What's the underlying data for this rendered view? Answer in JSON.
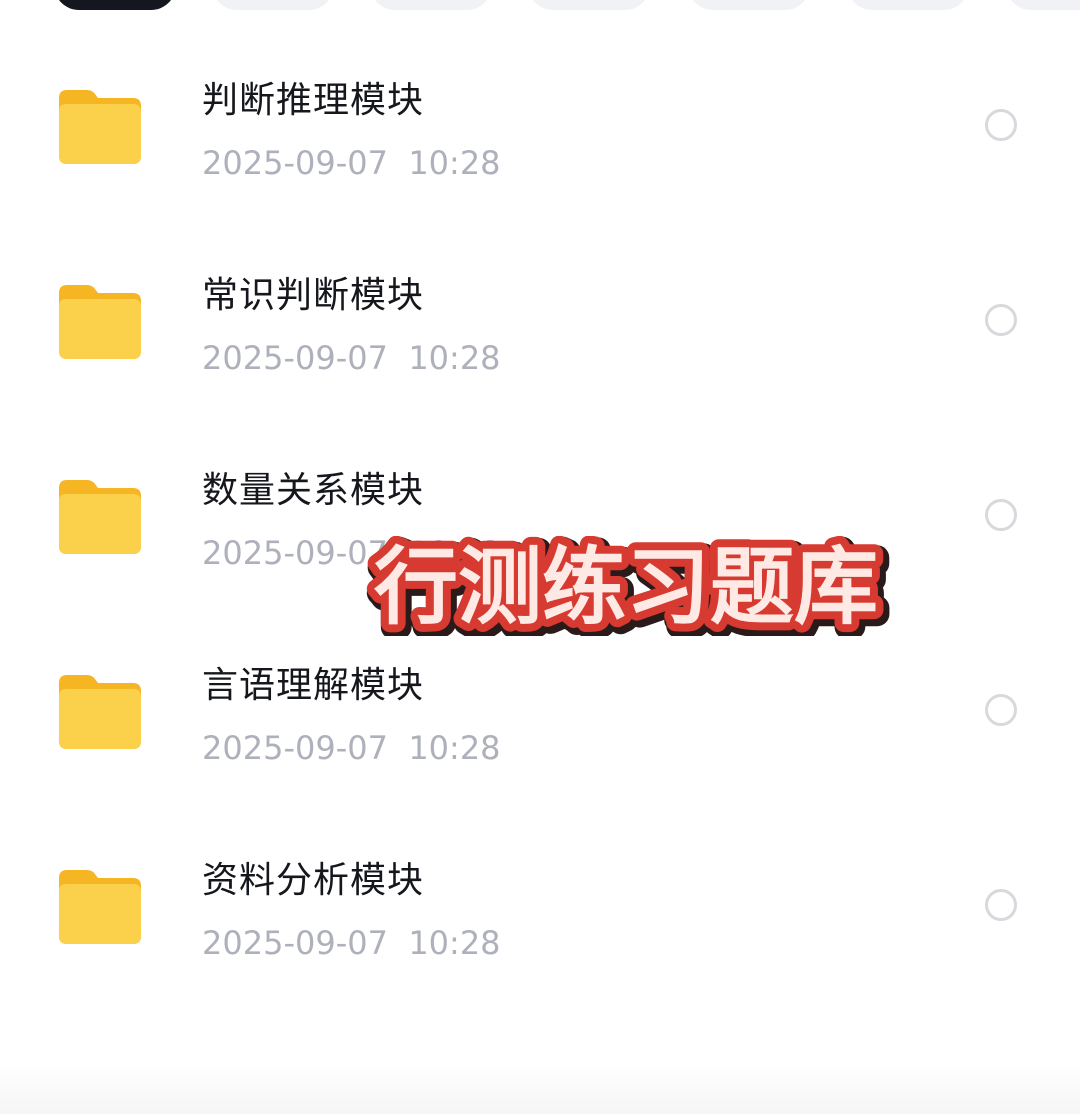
{
  "tabs": [
    {
      "active": true
    },
    {
      "active": false
    },
    {
      "active": false
    },
    {
      "active": false
    },
    {
      "active": false
    },
    {
      "active": false
    },
    {
      "active": false
    }
  ],
  "files": [
    {
      "name": "判断推理模块",
      "date": "2025-09-07  10:28",
      "icon": "folder-icon"
    },
    {
      "name": "常识判断模块",
      "date": "2025-09-07  10:28",
      "icon": "folder-icon"
    },
    {
      "name": "数量关系模块",
      "date": "2025-09-07  10:28",
      "icon": "folder-icon"
    },
    {
      "name": "言语理解模块",
      "date": "2025-09-07  10:28",
      "icon": "folder-icon"
    },
    {
      "name": "资料分析模块",
      "date": "2025-09-07  10:28",
      "icon": "folder-icon"
    }
  ],
  "overlay": {
    "title": "行测练习题库",
    "text_color": "#ffe9e4",
    "outline_color": "#d63a30",
    "shadow_color": "#2a1a1a"
  },
  "colors": {
    "folder_front": "#fbd04a",
    "folder_back": "#f6b624",
    "date_text": "#aeb1bb"
  }
}
